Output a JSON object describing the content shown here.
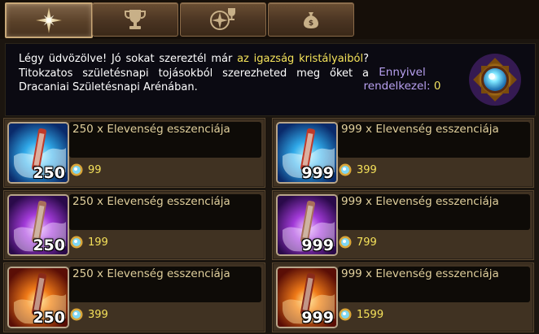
{
  "tabs": [
    {
      "name": "crystal-shop",
      "icon": "star-compass-icon",
      "active": true
    },
    {
      "name": "trophy",
      "icon": "trophy-icon",
      "active": false
    },
    {
      "name": "compass-trophy",
      "icon": "compass-trophy-icon",
      "active": false
    },
    {
      "name": "money-bag",
      "icon": "money-bag-icon",
      "active": false
    }
  ],
  "banner": {
    "text_before": "Légy üdvözölve! Jó sokat szereztél már ",
    "highlight": "az igazság kristályaiból",
    "text_after": "? Titokzatos születésnapi tojásokból szerezheted meg őket a Dracaniai Születésnapi Arénában.",
    "balance_label": "Ennyivel rendelkezel:",
    "balance_value": "0",
    "emblem_icon": "truth-crystal-icon"
  },
  "items": [
    {
      "quantity": "250",
      "name": "250 x Elevenség esszenciája",
      "price": "99",
      "element": "blue"
    },
    {
      "quantity": "999",
      "name": "999 x Elevenség esszenciája",
      "price": "399",
      "element": "blue"
    },
    {
      "quantity": "250",
      "name": "250 x Elevenség esszenciája",
      "price": "199",
      "element": "purple"
    },
    {
      "quantity": "999",
      "name": "999 x Elevenség esszenciája",
      "price": "799",
      "element": "purple"
    },
    {
      "quantity": "250",
      "name": "250 x Elevenség esszenciája",
      "price": "399",
      "element": "red"
    },
    {
      "quantity": "999",
      "name": "999 x Elevenség esszenciája",
      "price": "1599",
      "element": "red"
    }
  ],
  "colors": {
    "highlight": "#f5e35a",
    "balance_label": "#b8a0f0",
    "price": "#f4e05a",
    "item_name": "#e0cf9c"
  }
}
